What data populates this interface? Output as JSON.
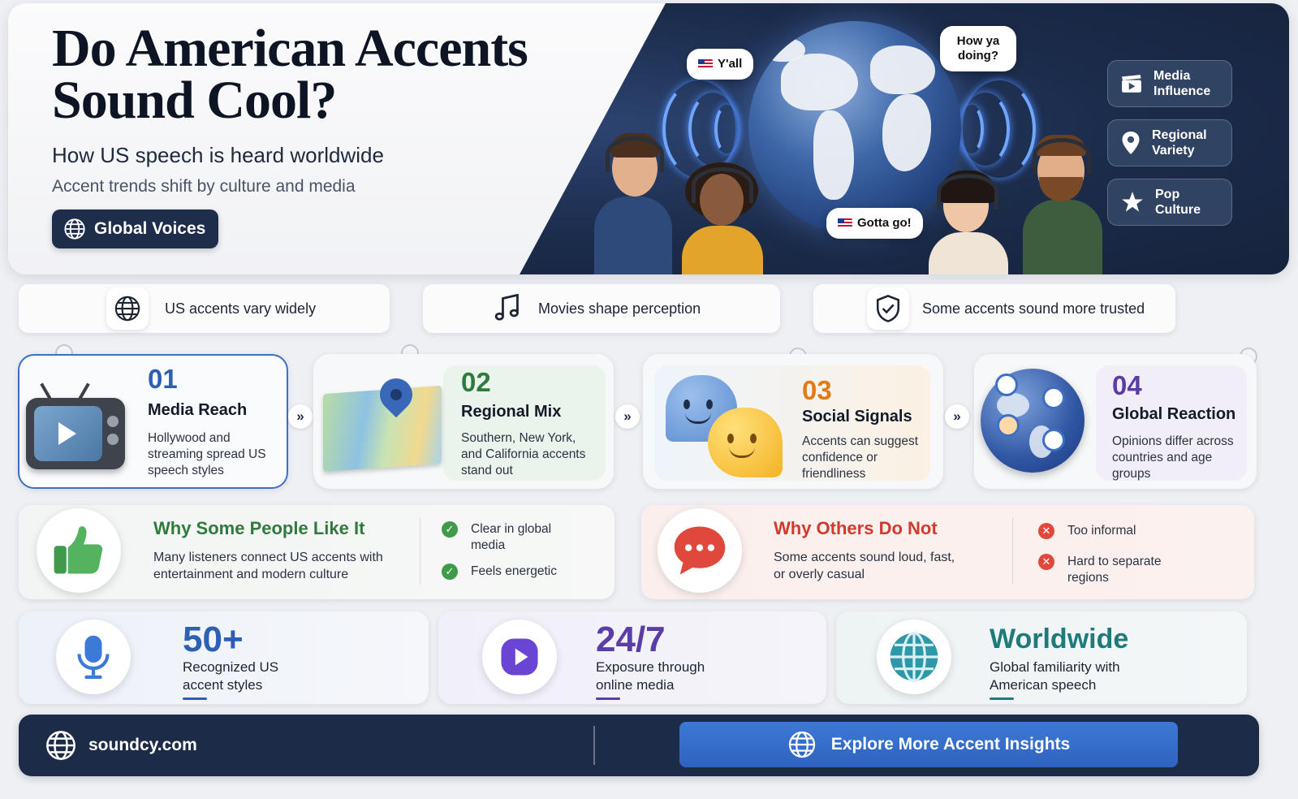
{
  "hero": {
    "title": "Do American Accents Sound Cool?",
    "subtitle": "How US speech is heard worldwide",
    "tagline": "Accent trends shift by culture and media",
    "pill_label": "Global Voices",
    "bubbles": {
      "yall": "Y'all",
      "how": "How ya doing?",
      "gotta": "Gotta go!"
    },
    "side_buttons": [
      {
        "label": "Media Influence",
        "icon": "clapperboard-icon"
      },
      {
        "label": "Regional Variety",
        "icon": "location-pin-icon"
      },
      {
        "label": "Pop Culture",
        "icon": "star-icon"
      }
    ]
  },
  "facts": [
    {
      "label": "US accents vary widely",
      "icon": "globe-icon"
    },
    {
      "label": "Movies shape perception",
      "icon": "music-note-icon"
    },
    {
      "label": "Some accents sound more trusted",
      "icon": "shield-check-icon"
    }
  ],
  "steps": [
    {
      "num": "01",
      "title": "Media Reach",
      "desc": "Hollywood and streaming spread US speech styles",
      "color": "#2d5fb4",
      "icon": "tv-icon"
    },
    {
      "num": "02",
      "title": "Regional Mix",
      "desc": "Southern, New York, and California accents stand out",
      "color": "#2f7a3c",
      "icon": "map-icon"
    },
    {
      "num": "03",
      "title": "Social Signals",
      "desc": "Accents can suggest confidence or friendliness",
      "color": "#e07b1a",
      "icon": "chat-faces-icon"
    },
    {
      "num": "04",
      "title": "Global Reaction",
      "desc": "Opinions differ across countries and age groups",
      "color": "#5a3da6",
      "icon": "globe-people-icon"
    }
  ],
  "opinions": {
    "like": {
      "title": "Why Some People Like It",
      "desc": "Many listeners connect US accents with entertainment and modern culture",
      "points": [
        "Clear in global media",
        "Feels energetic"
      ],
      "color": "#2f7a3c"
    },
    "dislike": {
      "title": "Why Others Do Not",
      "desc": "Some accents sound loud, fast, or overly casual",
      "points": [
        "Too informal",
        "Hard to separate regions"
      ],
      "color": "#d2392b"
    }
  },
  "stats": [
    {
      "value": "50+",
      "label": "Recognized US accent styles",
      "color": "#2d5fb4",
      "icon": "microphone-icon"
    },
    {
      "value": "24/7",
      "label": "Exposure through online media",
      "color": "#5a3da6",
      "icon": "play-icon"
    },
    {
      "value": "Worldwide",
      "label": "Global familiarity with American speech",
      "color": "#1f7a7a",
      "icon": "globe-icon"
    }
  ],
  "footer": {
    "site": "soundcy.com",
    "cta": "Explore More Accent Insights"
  }
}
